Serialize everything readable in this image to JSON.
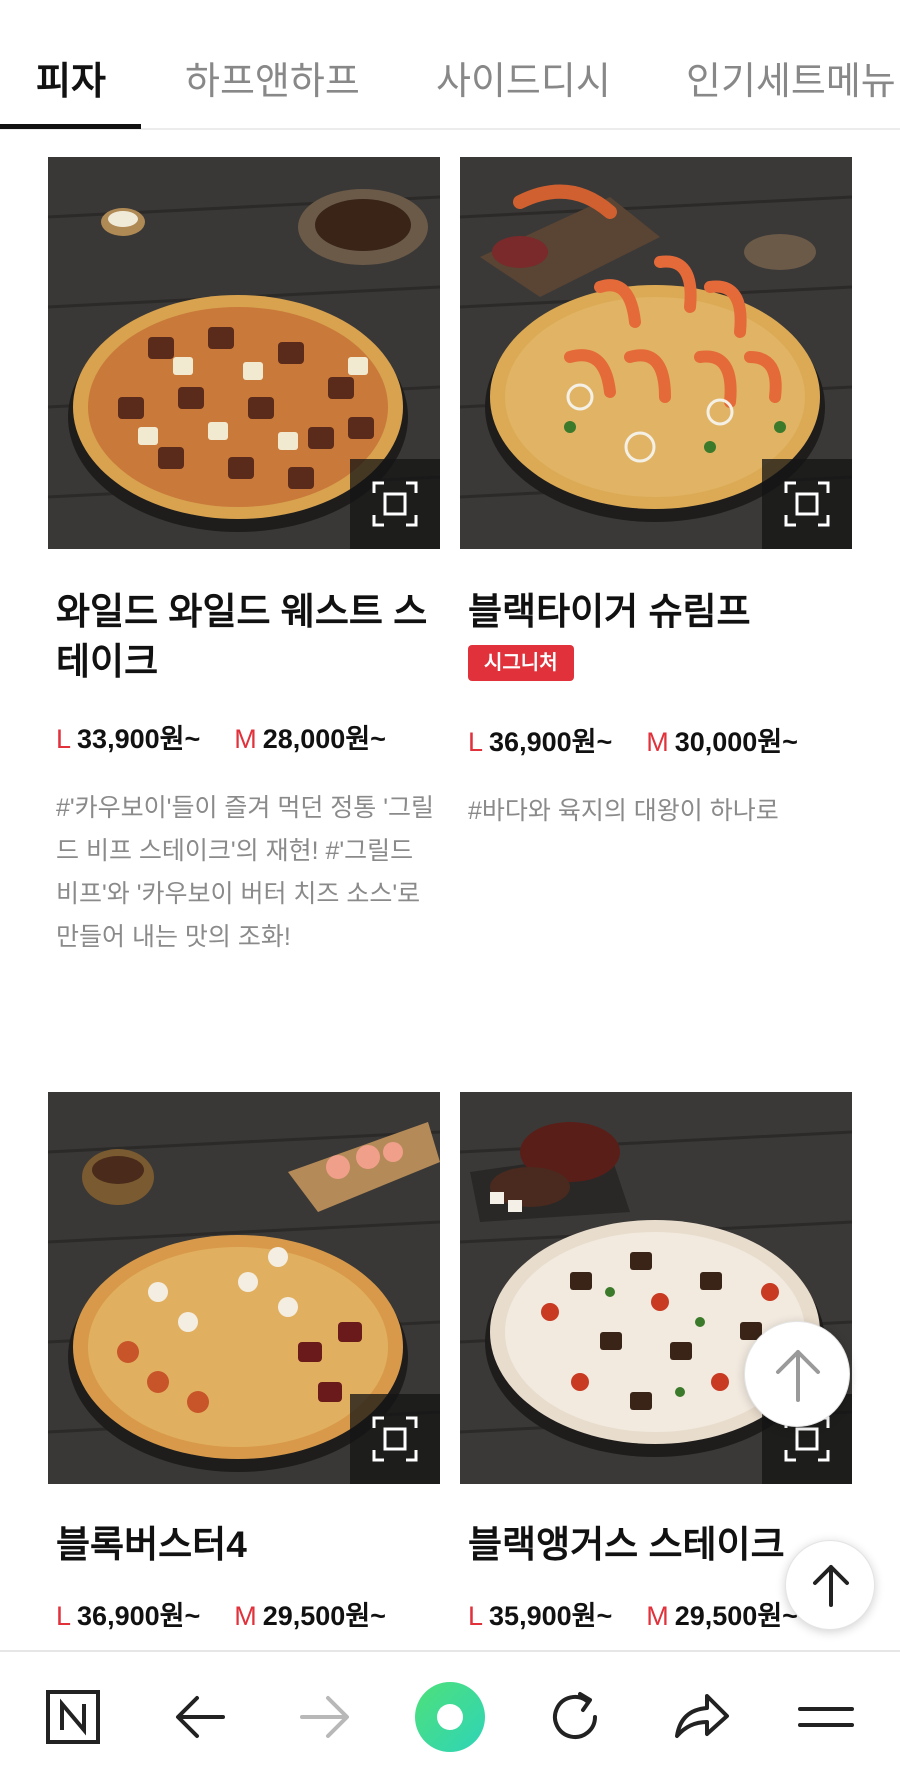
{
  "tabs": [
    {
      "label": "피자",
      "active": true
    },
    {
      "label": "하프앤하프",
      "active": false
    },
    {
      "label": "사이드디시",
      "active": false
    },
    {
      "label": "인기세트메뉴",
      "active": false
    }
  ],
  "products": [
    {
      "name": "와일드 와일드 웨스트 스테이크",
      "price_l_size": "L",
      "price_l": "33,900원~",
      "price_m_size": "M",
      "price_m": "28,000원~",
      "description": "#'카우보이'들이 즐겨 먹던 정통 '그릴드 비프 스테이크'의 재현! #'그릴드 비프'와 '카우보이 버터 치즈 소스'로 만들어 내는 맛의 조화!"
    },
    {
      "name": "블랙타이거 슈림프",
      "badge": "시그니처",
      "price_l_size": "L",
      "price_l": "36,900원~",
      "price_m_size": "M",
      "price_m": "30,000원~",
      "description": "#바다와 육지의 대왕이 하나로"
    },
    {
      "name": "블록버스터4",
      "price_l_size": "L",
      "price_l": "36,900원~",
      "price_m_size": "M",
      "price_m": "29,500원~"
    },
    {
      "name": "블랙앵거스 스테이크",
      "price_l_size": "L",
      "price_l": "35,900원~",
      "price_m_size": "M",
      "price_m": "29,500원~"
    }
  ],
  "icons": {
    "zoom": "fullscreen-icon",
    "scroll_top": "arrow-up-icon",
    "nav_home": "naver-n-icon",
    "nav_back": "arrow-left-icon",
    "nav_forward": "arrow-right-icon",
    "nav_center": "green-circle-icon",
    "nav_reload": "reload-icon",
    "nav_share": "share-icon",
    "nav_menu": "menu-icon"
  },
  "colors": {
    "accent": "#e1323c",
    "active_tab": "#111111",
    "inactive_tab": "#888888",
    "nav_green": "#3ddc84"
  }
}
